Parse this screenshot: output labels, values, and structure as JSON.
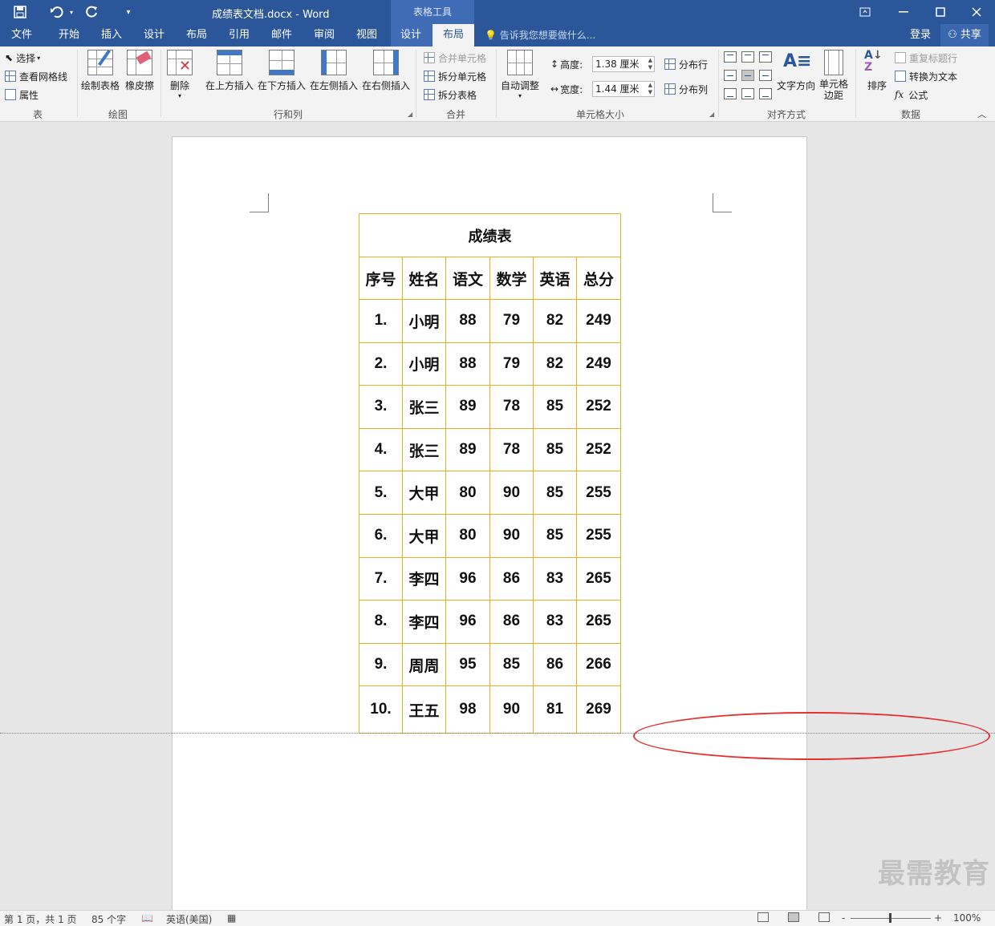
{
  "window": {
    "title": "成绩表文档.docx - Word",
    "context_tab_group": "表格工具",
    "qat": {
      "save_icon": "save-icon",
      "undo_icon": "undo-icon",
      "redo_icon": "redo-icon",
      "customize_icon": "customize-icon"
    },
    "controls": {
      "ribbon_display": "ribbon-display-icon",
      "minimize": "minimize-icon",
      "maximize": "maximize-icon",
      "close": "close-icon"
    }
  },
  "tabs": [
    "文件",
    "开始",
    "插入",
    "设计",
    "布局",
    "引用",
    "邮件",
    "审阅",
    "视图",
    "设计",
    "布局"
  ],
  "active_tab": "布局",
  "tell_me": "告诉我您想要做什么...",
  "account": {
    "login": "登录",
    "share": "共享"
  },
  "ribbon": {
    "table_group": {
      "label": "表",
      "select": "选择",
      "view_gridlines": "查看网格线",
      "properties": "属性"
    },
    "draw_group": {
      "label": "绘图",
      "draw_table": "绘制表格",
      "eraser": "橡皮擦"
    },
    "rows_cols_group": {
      "label": "行和列",
      "delete": "删除",
      "insert_above": "在上方插入",
      "insert_below": "在下方插入",
      "insert_left": "在左侧插入",
      "insert_right": "在右侧插入"
    },
    "merge_group": {
      "label": "合并",
      "merge_cells": "合并单元格",
      "split_cells": "拆分单元格",
      "split_table": "拆分表格"
    },
    "cell_size_group": {
      "label": "单元格大小",
      "autofit": "自动调整",
      "height_label": "高度:",
      "height_value": "1.38 厘米",
      "width_label": "宽度:",
      "width_value": "1.44 厘米",
      "distribute_rows": "分布行",
      "distribute_cols": "分布列"
    },
    "alignment_group": {
      "label": "对齐方式",
      "text_direction": "文字方向",
      "cell_margins": "单元格\n边距"
    },
    "data_group": {
      "label": "数据",
      "sort": "排序",
      "repeat_header": "重复标题行",
      "convert_text": "转换为文本",
      "formula": "公式"
    }
  },
  "table": {
    "title": "成绩表",
    "headers": [
      "序号",
      "姓名",
      "语文",
      "数学",
      "英语",
      "总分"
    ],
    "rows": [
      [
        "1.",
        "小明",
        "88",
        "79",
        "82",
        "249"
      ],
      [
        "2.",
        "小明",
        "88",
        "79",
        "82",
        "249"
      ],
      [
        "3.",
        "张三",
        "89",
        "78",
        "85",
        "252"
      ],
      [
        "4.",
        "张三",
        "89",
        "78",
        "85",
        "252"
      ],
      [
        "5.",
        "大甲",
        "80",
        "90",
        "85",
        "255"
      ],
      [
        "6.",
        "大甲",
        "80",
        "90",
        "85",
        "255"
      ],
      [
        "7.",
        "李四",
        "96",
        "86",
        "83",
        "265"
      ],
      [
        "8.",
        "李四",
        "96",
        "86",
        "83",
        "265"
      ],
      [
        "9.",
        "周周",
        "95",
        "85",
        "86",
        "266"
      ],
      [
        "10.",
        "王五",
        "98",
        "90",
        "81",
        "269"
      ]
    ],
    "border_color": "#e8b020"
  },
  "annotation_color": "#e53030",
  "watermark": "最需教育",
  "status": {
    "page": "第 1 页，共 1 页",
    "words": "85 个字",
    "language": "英语(美国)",
    "zoom": "100%",
    "zoom_minus": "-",
    "zoom_plus": "+"
  },
  "colors": {
    "title_bar": "#2b579a",
    "context_band": "#3f6cb5"
  }
}
